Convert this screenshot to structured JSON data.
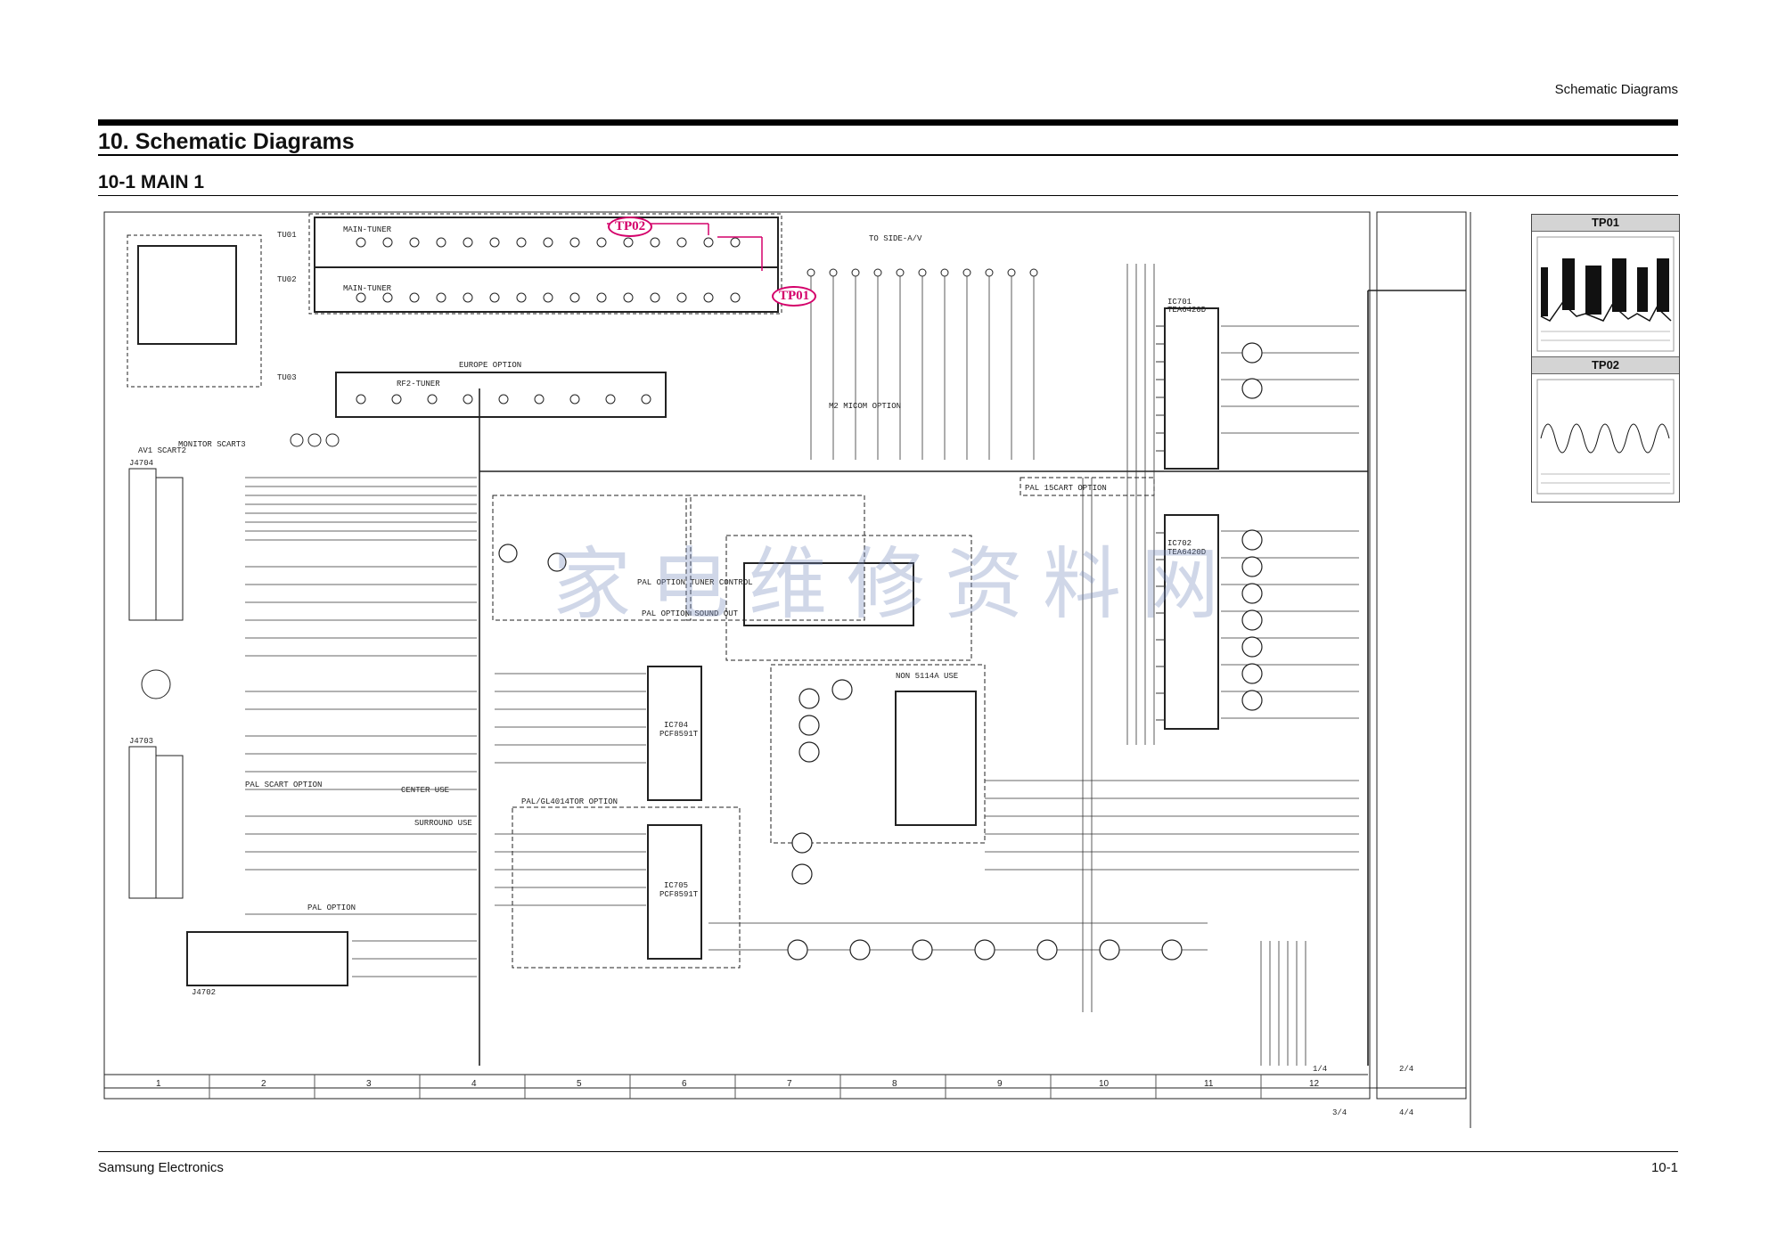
{
  "header": {
    "section_right": "Schematic Diagrams"
  },
  "title": "10. Schematic Diagrams",
  "subtitle": "10-1 MAIN 1",
  "footer": {
    "company": "Samsung Electronics",
    "page": "10-1"
  },
  "test_points": {
    "tp01": {
      "label": "TP01"
    },
    "tp02": {
      "label": "TP02"
    }
  },
  "schematic": {
    "tuners": [
      "MAIN-TUNER",
      "MAIN-TUNER",
      "RF2-TUNER"
    ],
    "tuner_parts": [
      "TU01",
      "TU02",
      "TU03"
    ],
    "ics": [
      {
        "id": "IC701",
        "part": "TEA6420D"
      },
      {
        "id": "IC702",
        "part": "TEA6420D"
      },
      {
        "id": "IC704",
        "part": "PCF8591T"
      },
      {
        "id": "IC705",
        "part": "PCF8591T"
      }
    ],
    "options": [
      "TO SIDE-A/V",
      "EUROPE OPTION",
      "PAL SCART OPTION",
      "PAL OPTION",
      "CENTER USE",
      "SURROUND USE",
      "NON 5114A USE",
      "PAL 15CART OPTION",
      "PAL OPTION TUNER CONTROL",
      "PAL OPTION SOUND OUT",
      "M2 MICOM OPTION",
      "PAL/GL4014TOR OPTION"
    ],
    "connectors": [
      "AV1 SCART2",
      "MONITOR SCART3",
      "J4704",
      "J4703",
      "J4702"
    ],
    "column_numbers": [
      "1",
      "2",
      "3",
      "4",
      "5",
      "6",
      "7",
      "8",
      "9",
      "10",
      "11",
      "12"
    ],
    "sheet_refs": {
      "a": "1/4",
      "b": "2/4",
      "c": "3/4",
      "d": "4/4"
    },
    "watermark": "家电维修资料网"
  }
}
